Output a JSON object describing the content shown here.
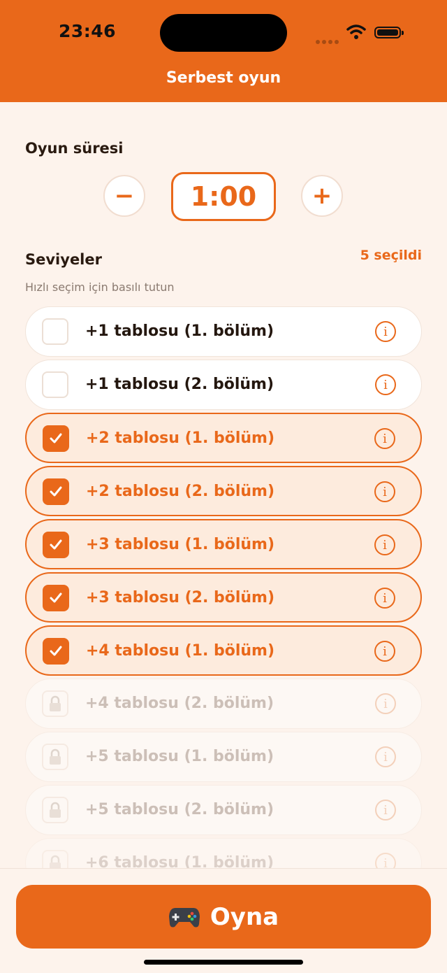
{
  "status_bar": {
    "time": "23:46"
  },
  "header": {
    "title": "Serbest oyun"
  },
  "duration": {
    "title": "Oyun süresi",
    "value": "1:00",
    "decrement_label": "−",
    "increment_label": "+"
  },
  "levels": {
    "title": "Seviyeler",
    "selected_count": "5 seçildi",
    "hint": "Hızlı seçim için basılı tutun",
    "items": [
      {
        "label": "+1 tablosu (1. bölüm)",
        "state": "unchecked"
      },
      {
        "label": "+1 tablosu (2. bölüm)",
        "state": "unchecked"
      },
      {
        "label": "+2 tablosu (1. bölüm)",
        "state": "checked"
      },
      {
        "label": "+2 tablosu (2. bölüm)",
        "state": "checked"
      },
      {
        "label": "+3 tablosu (1. bölüm)",
        "state": "checked"
      },
      {
        "label": "+3 tablosu (2. bölüm)",
        "state": "checked"
      },
      {
        "label": "+4 tablosu (1. bölüm)",
        "state": "checked"
      },
      {
        "label": "+4 tablosu (2. bölüm)",
        "state": "locked"
      },
      {
        "label": "+5 tablosu (1. bölüm)",
        "state": "locked"
      },
      {
        "label": "+5 tablosu (2. bölüm)",
        "state": "locked"
      },
      {
        "label": "+6 tablosu (1. bölüm)",
        "state": "locked"
      }
    ],
    "info_glyph": "i"
  },
  "play_button": {
    "label": "Oyna",
    "icon": "gamepad-icon"
  },
  "colors": {
    "accent": "#e9681a",
    "background": "#fdf3ec"
  }
}
